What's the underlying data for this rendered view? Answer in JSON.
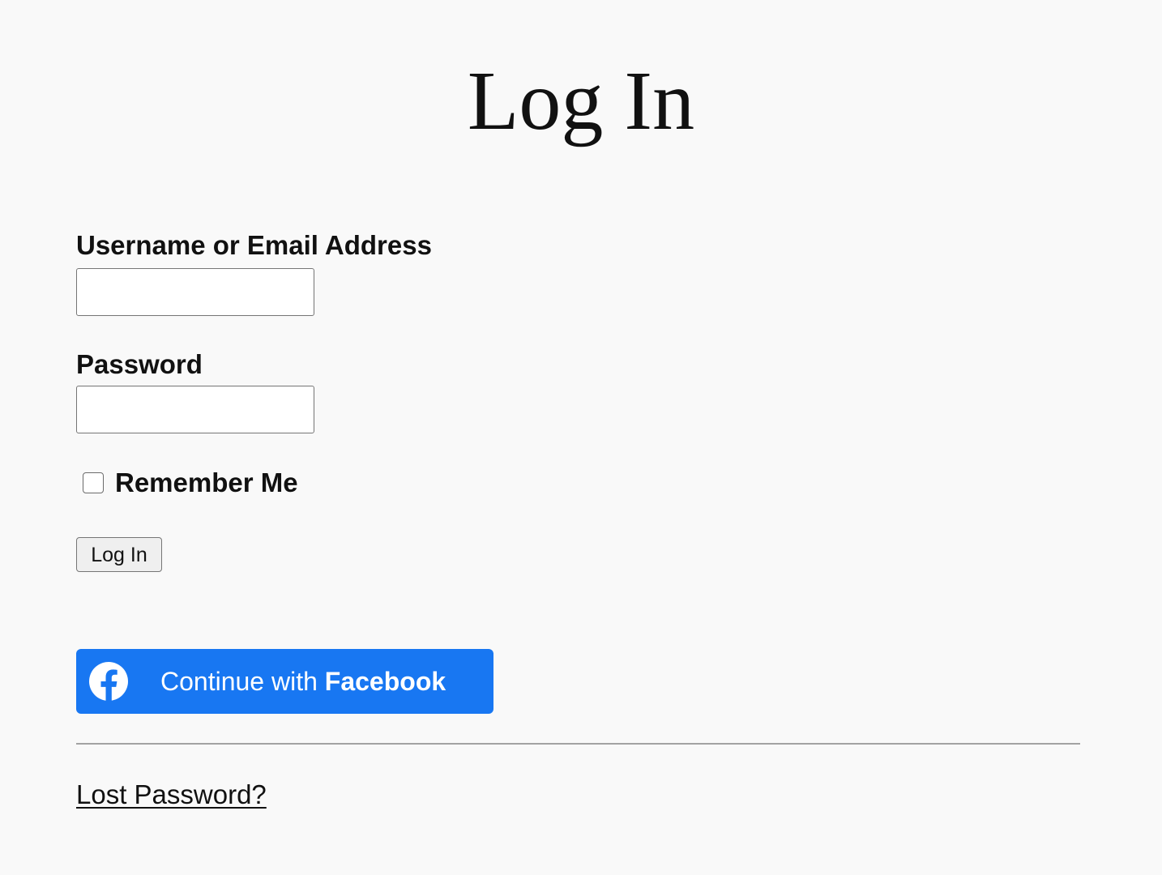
{
  "page": {
    "title": "Log In"
  },
  "form": {
    "username_label": "Username or Email Address",
    "username_value": "",
    "password_label": "Password",
    "password_value": "",
    "remember_label": "Remember Me",
    "remember_checked": false,
    "submit_label": "Log In"
  },
  "facebook": {
    "label_prefix": "Continue with ",
    "label_brand": "Facebook",
    "icon": "facebook-icon",
    "background_color": "#1877f2"
  },
  "footer": {
    "lost_password_label": "Lost Password?"
  },
  "colors": {
    "background": "#f9f9f9",
    "text": "#111111",
    "accent": "#1877f2"
  }
}
